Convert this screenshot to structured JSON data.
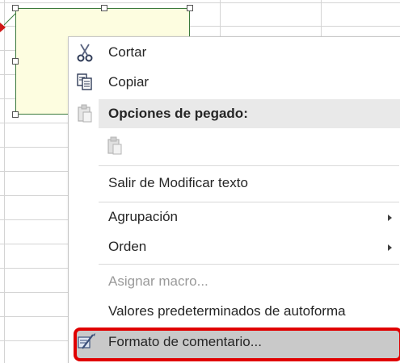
{
  "context_menu": {
    "items": [
      {
        "label": "Cortar",
        "access_key": "t",
        "icon": "scissors-icon",
        "enabled": true
      },
      {
        "label": "Copiar",
        "access_key": "C",
        "icon": "copy-icon",
        "enabled": true
      },
      {
        "label": "Opciones de pegado:",
        "icon": "paste-icon",
        "header": true
      },
      {
        "label": "",
        "icon": "paste-clipboard-icon",
        "enabled": false
      },
      {
        "label": "Salir de Modificar texto",
        "access_key": "x",
        "enabled": true
      },
      {
        "label": "Agrupación",
        "access_key": "g",
        "submenu": true,
        "enabled": true
      },
      {
        "label": "Orden",
        "access_key": "O",
        "submenu": true,
        "enabled": true
      },
      {
        "label": "Asignar macro...",
        "access_key": "s",
        "enabled": false
      },
      {
        "label": "Valores predeterminados de autoforma",
        "access_key": "V",
        "enabled": true
      },
      {
        "label": "Formato de comentario...",
        "access_key": "o",
        "icon": "format-comment-icon",
        "enabled": true,
        "highlighted": true
      }
    ]
  },
  "colors": {
    "comment_fill": "#fdfde0",
    "comment_border": "#3b7a3b",
    "highlight_outline": "#e00000",
    "hover_background": "#c9c9c9",
    "disabled_text": "#9a9a9a"
  }
}
